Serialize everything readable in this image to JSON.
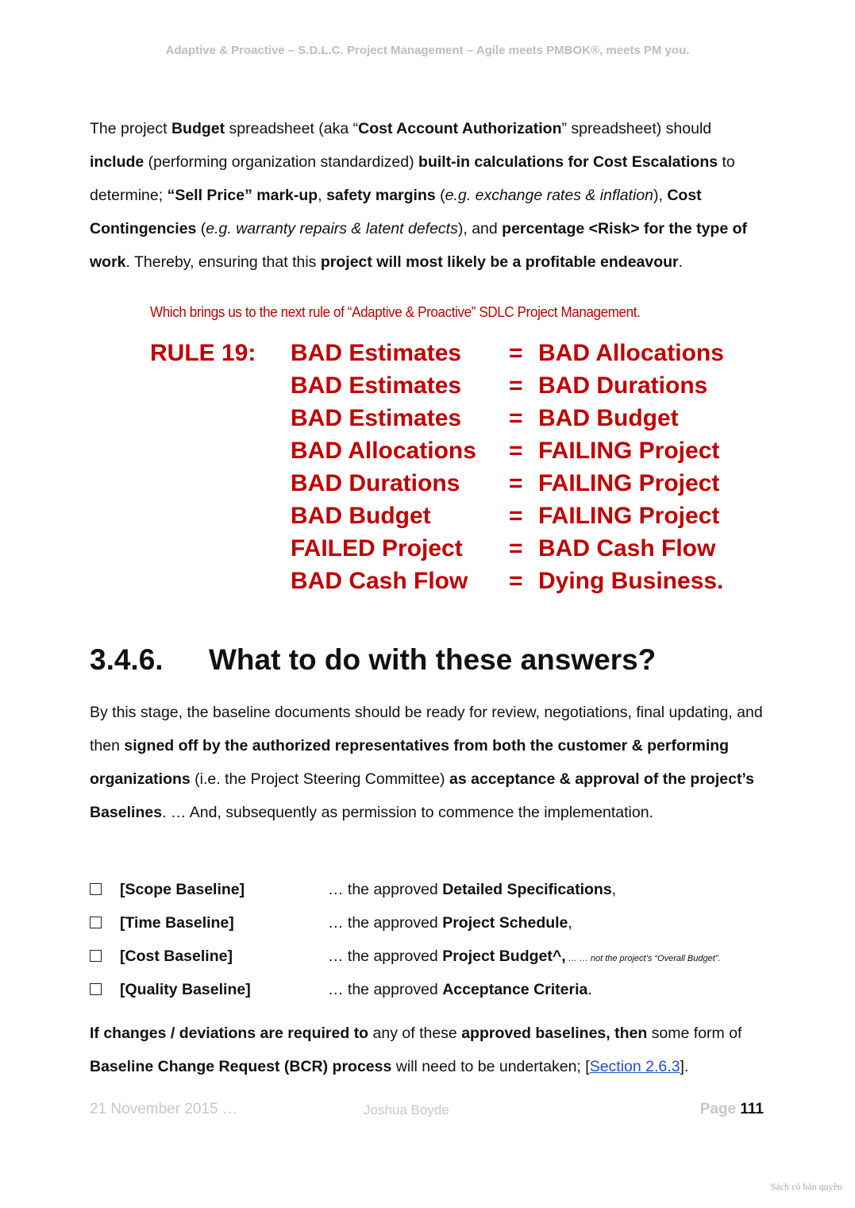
{
  "header": {
    "running_title": "Adaptive & Proactive – S.D.L.C. Project Management – Agile meets PMBOK®, meets PM you."
  },
  "budget_paragraph": {
    "t1": "The project ",
    "b1": "Budget",
    "t2": " spreadsheet (aka “",
    "b2": "Cost Account Authorization",
    "t3": "” spreadsheet) should ",
    "b3": "include",
    "t4": " (performing organization standardized) ",
    "b4": "built-in calculations for Cost Escalations",
    "t5": " to determine; ",
    "b5": "“Sell Price” mark-up",
    "t6": ", ",
    "b6": "safety margins",
    "t7": " (",
    "i1": "e.g. exchange rates & inflation",
    "t8": "), ",
    "b7": "Cost Contingencies",
    "t9": " (",
    "i2": "e.g. warranty repairs & latent defects",
    "t10": "), and ",
    "b8": "percentage <Risk> for the type of work",
    "t11": ".  Thereby, ensuring that this ",
    "b9": "project will most likely be a profitable endeavour",
    "t12": "."
  },
  "rule_intro": "Which brings us to the next rule of “Adaptive & Proactive” SDLC Project Management.",
  "rule": {
    "label": "RULE 19:",
    "equals": "=",
    "lines": [
      {
        "lhs": "BAD Estimates",
        "rhs": "BAD Allocations"
      },
      {
        "lhs": "BAD Estimates",
        "rhs": "BAD Durations"
      },
      {
        "lhs": "BAD Estimates",
        "rhs": "BAD Budget"
      },
      {
        "lhs": "BAD Allocations",
        "rhs": "FAILING Project"
      },
      {
        "lhs": "BAD Durations",
        "rhs": "FAILING Project"
      },
      {
        "lhs": "BAD Budget",
        "rhs": "FAILING Project"
      },
      {
        "lhs": "FAILED Project",
        "rhs": "BAD Cash Flow"
      },
      {
        "lhs": "BAD Cash Flow",
        "rhs": "Dying Business."
      }
    ]
  },
  "section": {
    "number": "3.4.6.",
    "title": "What to do with these answers?"
  },
  "answers_paragraph": {
    "t1": "By this stage, the baseline documents should be ready for review, negotiations, final updating, and then ",
    "b1": "signed off by the authorized representatives from both the customer & performing organizations",
    "t2": " (i.e. the Project Steering Committee) ",
    "b2": "as acceptance & approval of the project’s Baselines",
    "t3": ". … And, subsequently as permission to commence the implementation."
  },
  "baselines": [
    {
      "name": "[Scope Baseline]",
      "prefix": "… the approved ",
      "item": "Detailed Specifications",
      "suffix": ","
    },
    {
      "name": "[Time Baseline]",
      "prefix": "… the approved ",
      "item": "Project Schedule",
      "suffix": ","
    },
    {
      "name": "[Cost Baseline]",
      "prefix": "… the approved ",
      "item": "Project Budget^,",
      "suffix": "",
      "note": " … … not the project’s “Overall Budget”."
    },
    {
      "name": "[Quality Baseline]",
      "prefix": "… the approved ",
      "item": "Acceptance Criteria",
      "suffix": "."
    }
  ],
  "change_paragraph": {
    "b1": "If changes / deviations are required to",
    "t1": " any of these ",
    "b2": "approved baselines, then",
    "t2": " some form of ",
    "b3": "Baseline Change Request (BCR) process",
    "t3": " will need to be undertaken; [",
    "link": "Section 2.6.3",
    "t4": "]."
  },
  "footer": {
    "date": "21 November 2015 …",
    "author": "Joshua Boyde",
    "page_label": "Page ",
    "page_number": "111"
  },
  "watermark": "Sách có bản quyền"
}
